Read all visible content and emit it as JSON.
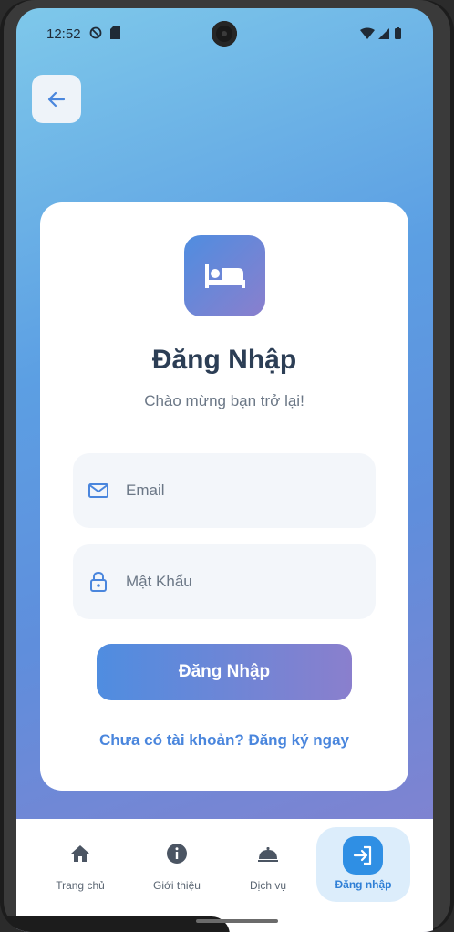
{
  "status_bar": {
    "time": "12:52"
  },
  "card": {
    "title": "Đăng Nhập",
    "subtitle": "Chào mừng bạn trở lại!",
    "email_placeholder": "Email",
    "password_placeholder": "Mật Khẩu",
    "login_button": "Đăng Nhập",
    "register_link": "Chưa có tài khoản? Đăng ký ngay"
  },
  "bottom_nav": {
    "items": [
      {
        "label": "Trang chủ",
        "icon": "home-icon"
      },
      {
        "label": "Giới thiệu",
        "icon": "info-icon"
      },
      {
        "label": "Dịch vụ",
        "icon": "room-service-icon"
      },
      {
        "label": "Đăng nhập",
        "icon": "login-icon",
        "active": true
      }
    ]
  },
  "colors": {
    "accent": "#4a86dd",
    "gradient_start": "#4f8de0",
    "gradient_end": "#8a7fcd",
    "title": "#2c3e55",
    "nav_active": "#2f8fe4"
  }
}
